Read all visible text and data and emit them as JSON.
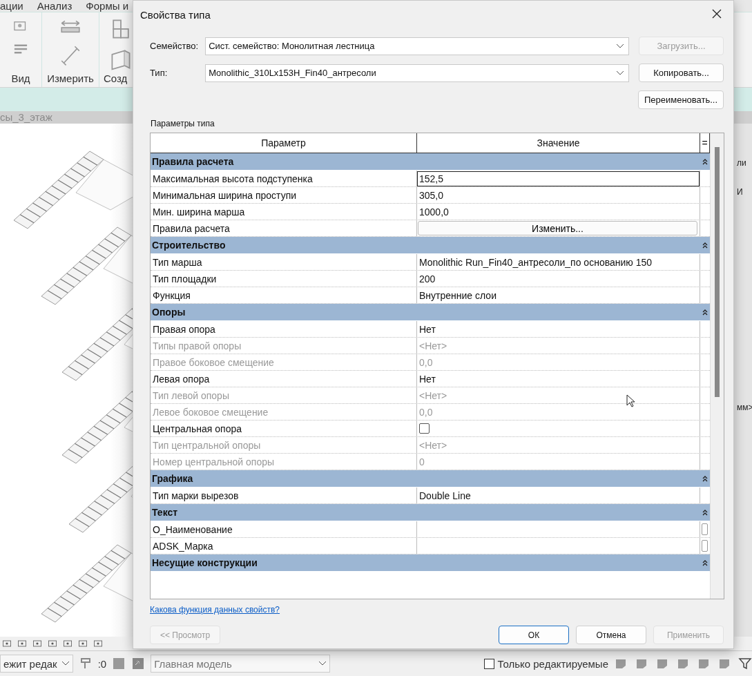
{
  "app": {
    "ribbon_tabs": [
      "ации",
      "Анализ",
      "Формы и"
    ],
    "ribbon_panels": [
      "Вид",
      "Измерить",
      "Созд"
    ],
    "view_tab": "сы_3_этаж",
    "side_panel_texts": [
      "ли",
      "И",
      "мм>"
    ],
    "status_bar": {
      "mode": "ежит редак",
      "count": ":0",
      "model": "Главная модель",
      "editable_only": {
        "label": "Только редактируемые",
        "checked": false
      }
    }
  },
  "dialog": {
    "title": "Свойства типа",
    "family": {
      "label": "Семейство:",
      "value": "Сист. семейство: Монолитная лестница"
    },
    "type": {
      "label": "Тип:",
      "value": "Monolithic_310Lx153H_Fin40_антресоли"
    },
    "side_buttons": [
      {
        "label": "Загрузить...",
        "disabled": true
      },
      {
        "label": "Копировать...",
        "disabled": false
      },
      {
        "label": "Переименовать...",
        "disabled": false
      }
    ],
    "section_label": "Параметры типа",
    "columns": [
      "Параметр",
      "Значение",
      "="
    ],
    "groups": [
      {
        "name": "Правила расчета",
        "expanded": true,
        "rows": [
          {
            "name": "Максимальная высота подступенка",
            "value": "152,5",
            "kind": "edit",
            "disabled": false
          },
          {
            "name": "Минимальная ширина проступи",
            "value": "305,0",
            "kind": "text",
            "disabled": false
          },
          {
            "name": "Мин. ширина марша",
            "value": "1000,0",
            "kind": "text",
            "disabled": false
          },
          {
            "name": "Правила расчета",
            "value": "Изменить...",
            "kind": "button",
            "disabled": false
          }
        ]
      },
      {
        "name": "Строительство",
        "expanded": true,
        "rows": [
          {
            "name": "Тип марша",
            "value": "Monolithic Run_Fin40_антресоли_по основанию 150",
            "kind": "text",
            "disabled": false
          },
          {
            "name": "Тип площадки",
            "value": "200",
            "kind": "text",
            "disabled": false
          },
          {
            "name": "Функция",
            "value": "Внутренние слои",
            "kind": "text",
            "disabled": false
          }
        ]
      },
      {
        "name": "Опоры",
        "expanded": true,
        "rows": [
          {
            "name": "Правая опора",
            "value": "Нет",
            "kind": "text",
            "disabled": false
          },
          {
            "name": "Типы правой опоры",
            "value": "<Нет>",
            "kind": "text",
            "disabled": true
          },
          {
            "name": "Правое боковое смещение",
            "value": "0,0",
            "kind": "text",
            "disabled": true
          },
          {
            "name": "Левая опора",
            "value": "Нет",
            "kind": "text",
            "disabled": false
          },
          {
            "name": "Тип левой опоры",
            "value": "<Нет>",
            "kind": "text",
            "disabled": true
          },
          {
            "name": "Левое боковое смещение",
            "value": "0,0",
            "kind": "text",
            "disabled": true
          },
          {
            "name": "Центральная опора",
            "kind": "checkbox",
            "checked": false,
            "disabled": false
          },
          {
            "name": "Тип центральной опоры",
            "value": "<Нет>",
            "kind": "text",
            "disabled": true
          },
          {
            "name": "Номер центральной опоры",
            "value": "0",
            "kind": "text",
            "disabled": true
          }
        ]
      },
      {
        "name": "Графика",
        "expanded": true,
        "rows": [
          {
            "name": "Тип марки вырезов",
            "value": "Double Line",
            "kind": "text",
            "disabled": false
          }
        ]
      },
      {
        "name": "Текст",
        "expanded": true,
        "rows": [
          {
            "name": "О_Наименование",
            "kind": "text",
            "disabled": false,
            "associate": true
          },
          {
            "name": "ADSK_Марка",
            "kind": "text",
            "disabled": false,
            "associate": true
          }
        ]
      },
      {
        "name": "Несущие конструкции",
        "expanded": true
      }
    ],
    "help_link": "Какова функция данных свойств?",
    "preview_button": {
      "label": "<< Просмотр",
      "disabled": true
    },
    "footer_buttons": [
      {
        "label": "ОК",
        "disabled": false,
        "default": true
      },
      {
        "label": "Отмена",
        "disabled": false,
        "default": false
      },
      {
        "label": "Применить",
        "disabled": true,
        "default": false
      }
    ]
  }
}
